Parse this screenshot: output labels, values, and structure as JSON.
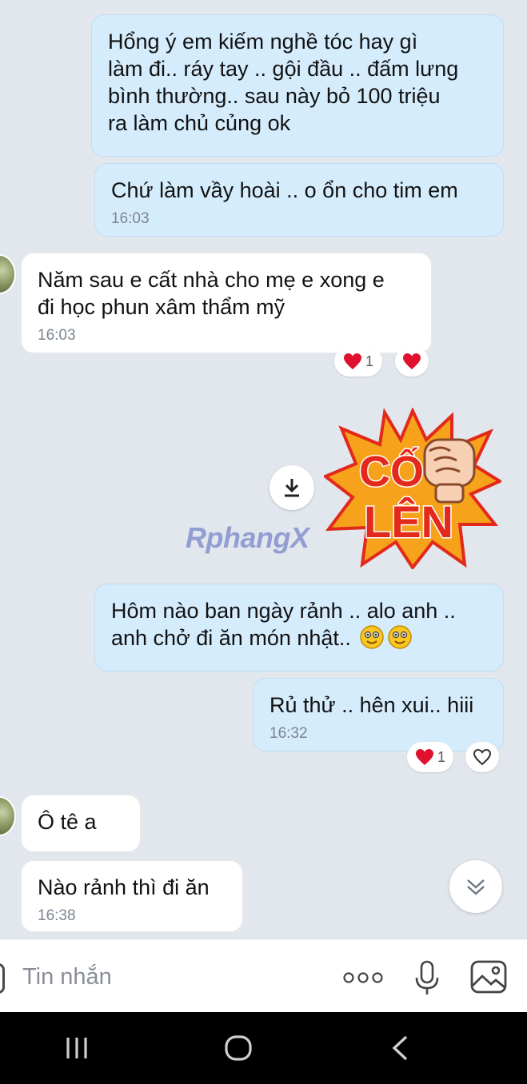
{
  "messages": [
    {
      "side": "out",
      "text": "Hổng ý em kiếm nghề tóc hay gì\nlàm đi.. ráy tay .. gội đầu .. đấm lưng\nbình thường.. sau này bỏ 100 triệu\nra làm chủ củng ok",
      "time": ""
    },
    {
      "side": "out",
      "text": "Chứ làm vầy hoài .. o ổn cho tim em",
      "time": "16:03"
    },
    {
      "side": "in",
      "text": "Năm sau e cất nhà cho mẹ e xong e\nđi học phun xâm thẩm mỹ",
      "time": "16:03"
    },
    {
      "side": "out",
      "text": "Hôm nào ban ngày rảnh .. alo anh ..\nanh chở đi ăn món nhật..",
      "time": ""
    },
    {
      "side": "out",
      "text": "Rủ thử .. hên xui.. hiii",
      "time": "16:32"
    },
    {
      "side": "in",
      "text": "Ô tê a",
      "time": ""
    },
    {
      "side": "in",
      "text": "Nào rảnh thì đi ăn",
      "time": "16:38"
    }
  ],
  "reactions": [
    {
      "emoji": "heart-icon",
      "count": "1"
    },
    {
      "emoji": "heart-icon",
      "count": "1"
    }
  ],
  "sticker": {
    "line1": "CỐ",
    "line2": "LÊN",
    "watermark": "RphangX"
  },
  "input": {
    "placeholder": "Tin nhắn",
    "value": ""
  },
  "colors": {
    "background": "#e2e7ee",
    "outgoing_bubble": "#d5ecfd",
    "incoming_bubble": "#ffffff",
    "heart": "#e0102f",
    "sticker_orange": "#f6a21b",
    "sticker_red": "#e2291c"
  }
}
